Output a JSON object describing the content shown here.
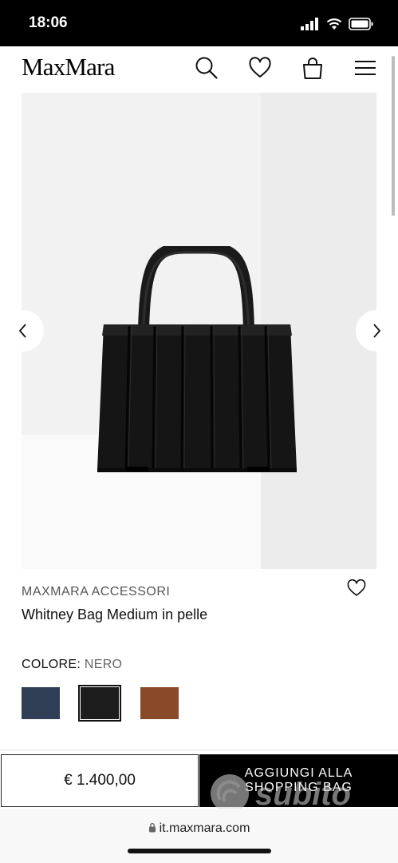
{
  "status": {
    "time": "18:06"
  },
  "header": {
    "logo": "MaxMara"
  },
  "product": {
    "brand": "MAXMARA ACCESSORI",
    "name": "Whitney Bag Medium in pelle",
    "color_key": "COLORE:",
    "color_value": "NERO",
    "swatches": [
      {
        "name": "blue",
        "color": "#2f3e55"
      },
      {
        "name": "black",
        "color": "#1d1d1d",
        "selected": true
      },
      {
        "name": "brown",
        "color": "#8a4a2a"
      }
    ]
  },
  "purchase": {
    "price": "€ 1.400,00",
    "add_line1": "AGGIUNGI ALLA",
    "add_line2": "SHOPPING BAG"
  },
  "browser": {
    "url": "it.maxmara.com"
  },
  "watermark": {
    "text": "subito"
  },
  "colors": {
    "accent": "#000000",
    "text_muted": "#666666"
  }
}
